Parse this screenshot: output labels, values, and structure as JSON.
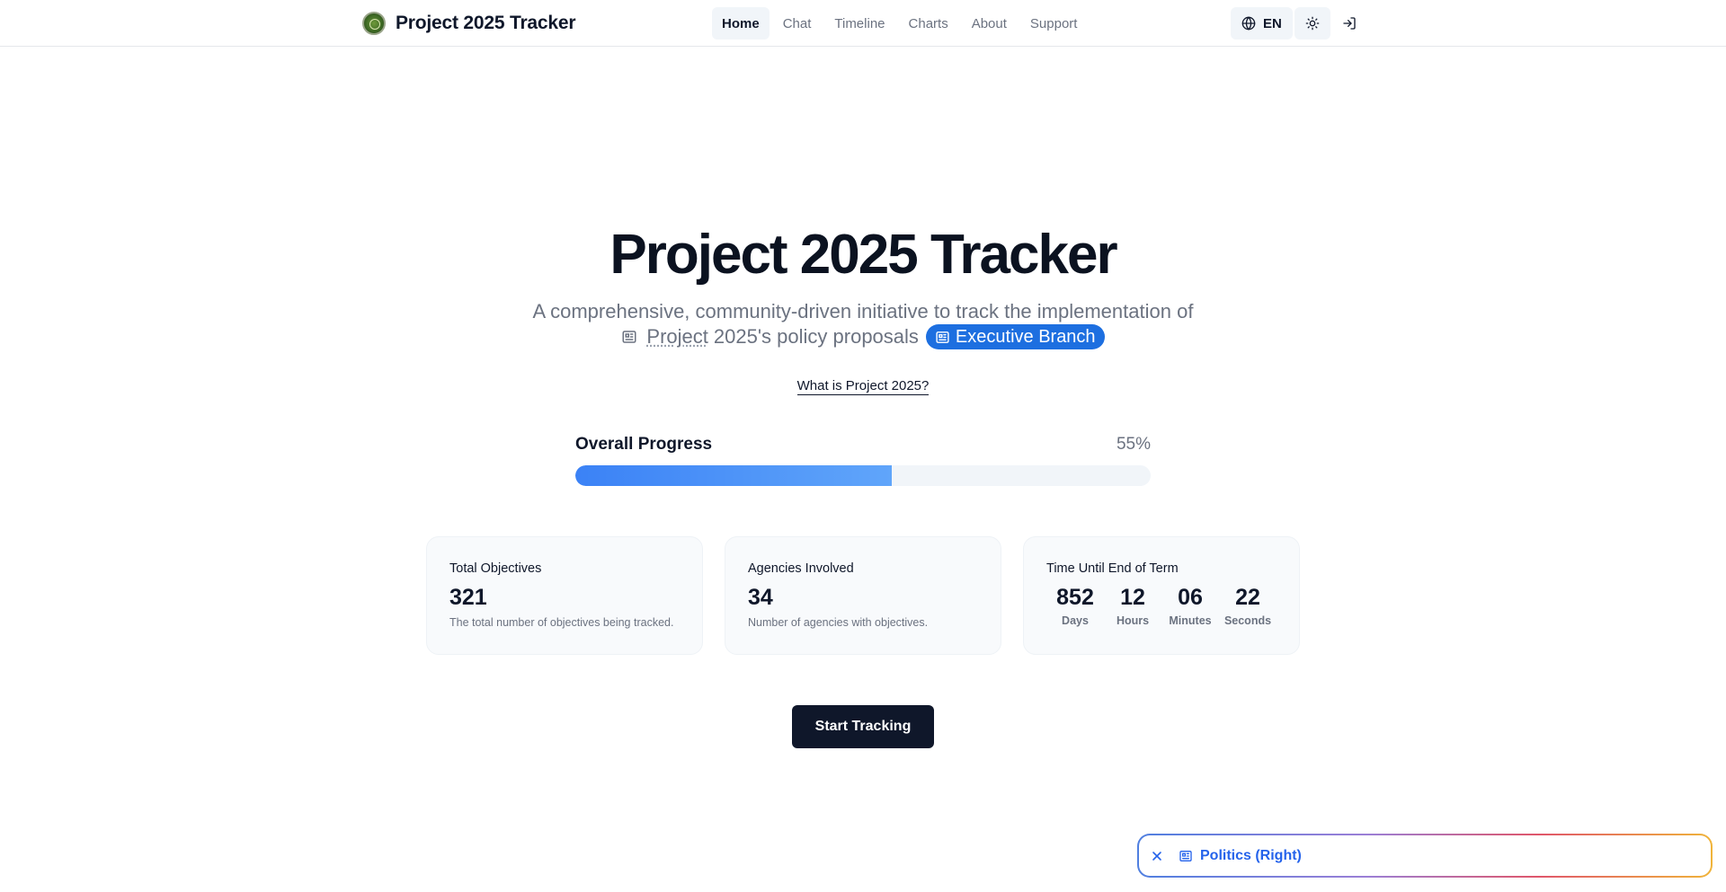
{
  "header": {
    "brand": "Project 2025 Tracker",
    "nav": [
      {
        "label": "Home",
        "active": true
      },
      {
        "label": "Chat",
        "active": false
      },
      {
        "label": "Timeline",
        "active": false
      },
      {
        "label": "Charts",
        "active": false
      },
      {
        "label": "About",
        "active": false
      },
      {
        "label": "Support",
        "active": false
      }
    ],
    "language": "EN",
    "icons": {
      "language": "globe-icon",
      "theme": "sun-icon",
      "login": "login-icon"
    }
  },
  "hero": {
    "title": "Project 2025 Tracker",
    "subtitle_line1": "A comprehensive, community-driven initiative to track the implementation of",
    "subtitle_project": "Project",
    "subtitle_rest": "2025's policy proposals",
    "badge": "Executive Branch",
    "what_is_link": "What is Project 2025?"
  },
  "progress": {
    "label": "Overall Progress",
    "percent_text": "55%",
    "percent": 55,
    "colors": {
      "fill_start": "#3b82f6",
      "fill_end": "#60a5fa",
      "track": "#f1f5f9"
    }
  },
  "stats": {
    "objectives": {
      "title": "Total Objectives",
      "value": "321",
      "description": "The total number of objectives being tracked."
    },
    "agencies": {
      "title": "Agencies Involved",
      "value": "34",
      "description": "Number of agencies with objectives."
    },
    "countdown": {
      "title": "Time Until End of Term",
      "units": [
        {
          "value": "852",
          "label": "Days"
        },
        {
          "value": "12",
          "label": "Hours"
        },
        {
          "value": "06",
          "label": "Minutes"
        },
        {
          "value": "22",
          "label": "Seconds"
        }
      ]
    }
  },
  "cta": {
    "label": "Start Tracking"
  },
  "topic_pill": {
    "label": "Politics (Right)",
    "accent": "#2563eb"
  },
  "colors": {
    "primary_dark": "#0f172a",
    "badge_blue": "#1d6fe0",
    "muted": "#6b7280"
  }
}
